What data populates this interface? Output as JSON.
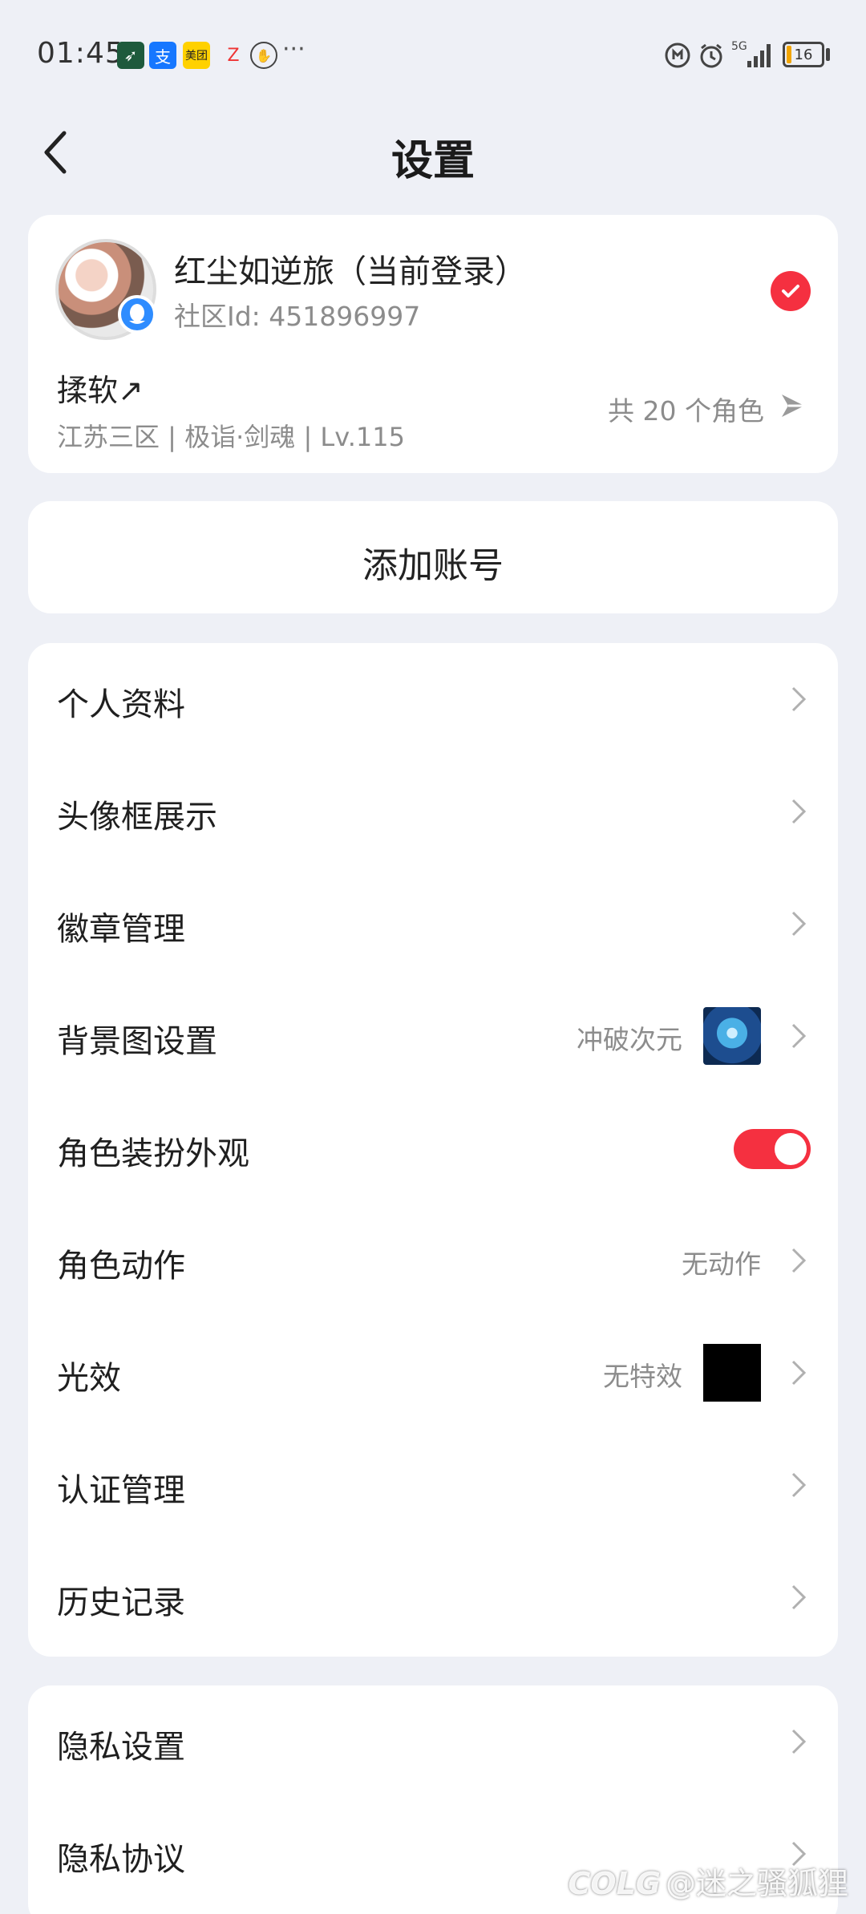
{
  "status_bar": {
    "time": "01:45",
    "notification_icons": [
      "vpn-icon",
      "alipay-icon",
      "meituan-icon",
      "app-icon",
      "gesture-icon"
    ],
    "dots": "···",
    "battery": "16",
    "network": "5G"
  },
  "header": {
    "title": "设置"
  },
  "account": {
    "name": "红尘如逆旅（当前登录）",
    "community_id": "社区Id: 451896997",
    "role_name": "揉软↗",
    "role_detail": "江苏三区 | 极诣·剑魂 | Lv.115",
    "role_count": "共 20 个角色"
  },
  "add_account": {
    "label": "添加账号"
  },
  "menu": {
    "personal_info": "个人资料",
    "avatar_frame": "头像框展示",
    "badge_manage": "徽章管理",
    "background_setting": "背景图设置",
    "background_value": "冲破次元",
    "costume_appearance": "角色装扮外观",
    "costume_enabled": true,
    "role_action": "角色动作",
    "role_action_value": "无动作",
    "light_effect": "光效",
    "light_effect_value": "无特效",
    "certification": "认证管理",
    "history": "历史记录"
  },
  "menu2": {
    "privacy_setting": "隐私设置",
    "privacy_agreement": "隐私协议"
  },
  "watermark": "@迷之骚狐狸",
  "colors": {
    "accent_red": "#f53040",
    "background": "#eef0f6",
    "card": "#ffffff",
    "secondary_text": "#8c8c8c"
  }
}
